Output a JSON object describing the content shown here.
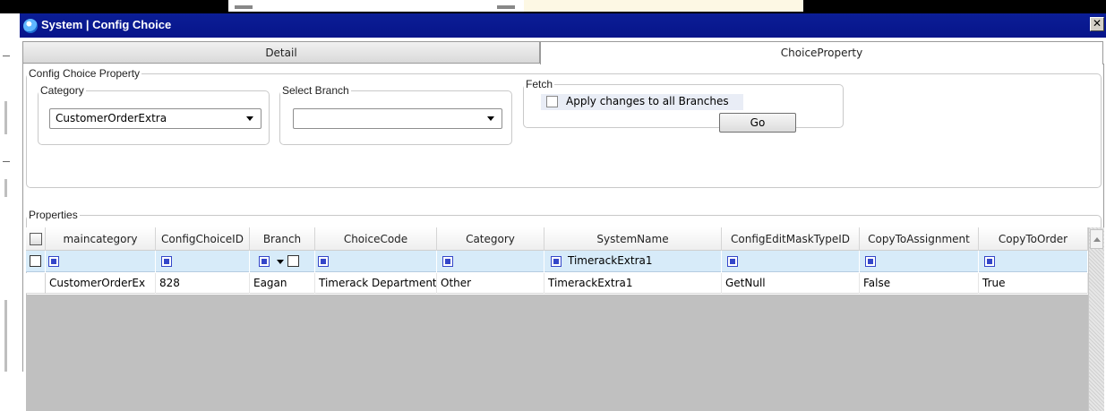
{
  "window": {
    "title": "System | Config Choice",
    "close_glyph": "✕"
  },
  "tabs": [
    {
      "label": "Detail",
      "selected": false
    },
    {
      "label": "ChoiceProperty",
      "selected": true
    }
  ],
  "config_choice_property": {
    "legend": "Config Choice Property",
    "category": {
      "legend": "Category",
      "value": "CustomerOrderExtra"
    },
    "select_branch": {
      "legend": "Select Branch",
      "value": ""
    },
    "fetch": {
      "legend": "Fetch",
      "apply_all_label": "Apply changes to all Branches",
      "apply_all_checked": false,
      "go_label": "Go"
    }
  },
  "properties": {
    "legend": "Properties",
    "columns": [
      "maincategory",
      "ConfigChoiceID",
      "Branch",
      "ChoiceCode",
      "Category",
      "SystemName",
      "ConfigEditMaskTypeID",
      "CopyToAssignment",
      "CopyToOrder"
    ],
    "filter": {
      "SystemName": "TimerackExtra1"
    },
    "rows": [
      {
        "maincategory": "CustomerOrderEx",
        "ConfigChoiceID": "828",
        "Branch": "Eagan",
        "ChoiceCode": "Timerack Department",
        "Category": "Other",
        "SystemName": "TimerackExtra1",
        "ConfigEditMaskTypeID": "GetNull",
        "CopyToAssignment": "False",
        "CopyToOrder": "True"
      }
    ]
  },
  "colors": {
    "titlebar": "#0b1e96",
    "filter_row": "#d7ebf9",
    "grid_empty": "#c0c0c0"
  }
}
